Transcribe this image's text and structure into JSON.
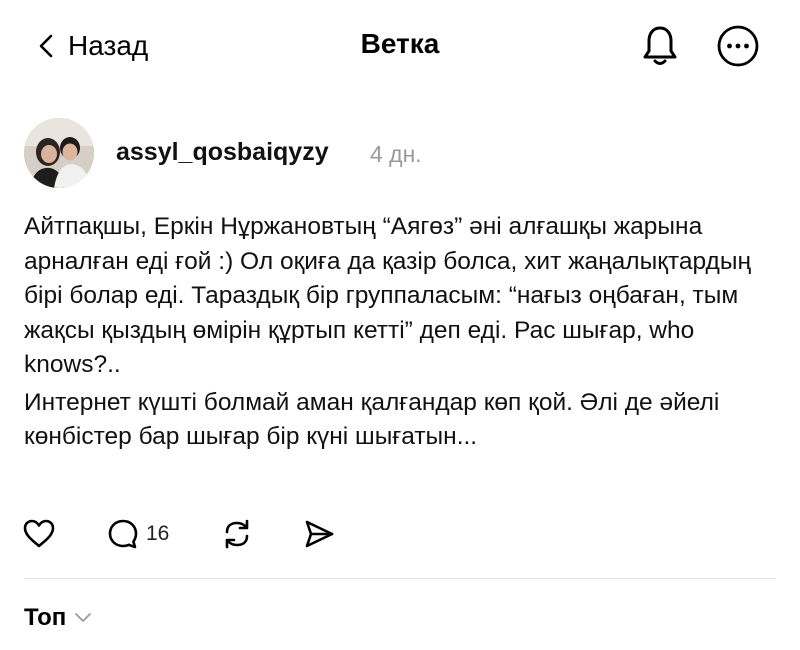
{
  "header": {
    "back_label": "Назад",
    "title": "Ветка",
    "icons": [
      "chevron-left-icon",
      "bell-icon",
      "more-icon"
    ]
  },
  "post": {
    "username": "assyl_qosbaiqyzy",
    "time": "4 дн.",
    "paragraph1": "Айтпақшы, Еркін Нұржановтың “Аягөз” әні алғашқы жарына арналған еді ғой :) Ол оқиға да қазір болса, хит жаңалықтардың бірі болар еді. Тараздық бір группаласым: “нағыз оңбаған, тым жақсы қыздың өмірін құртып кетті” деп еді. Рас шығар, who knows?..",
    "paragraph2": "Интернет күшті болмай аман қалғандар көп қой. Әлі де әйелі көнбістер бар шығар бір күні шығатын..."
  },
  "actions": {
    "comment_count": "16",
    "icons": [
      "heart-icon",
      "comment-icon",
      "repost-icon",
      "share-icon"
    ]
  },
  "sort": {
    "label": "Топ"
  }
}
